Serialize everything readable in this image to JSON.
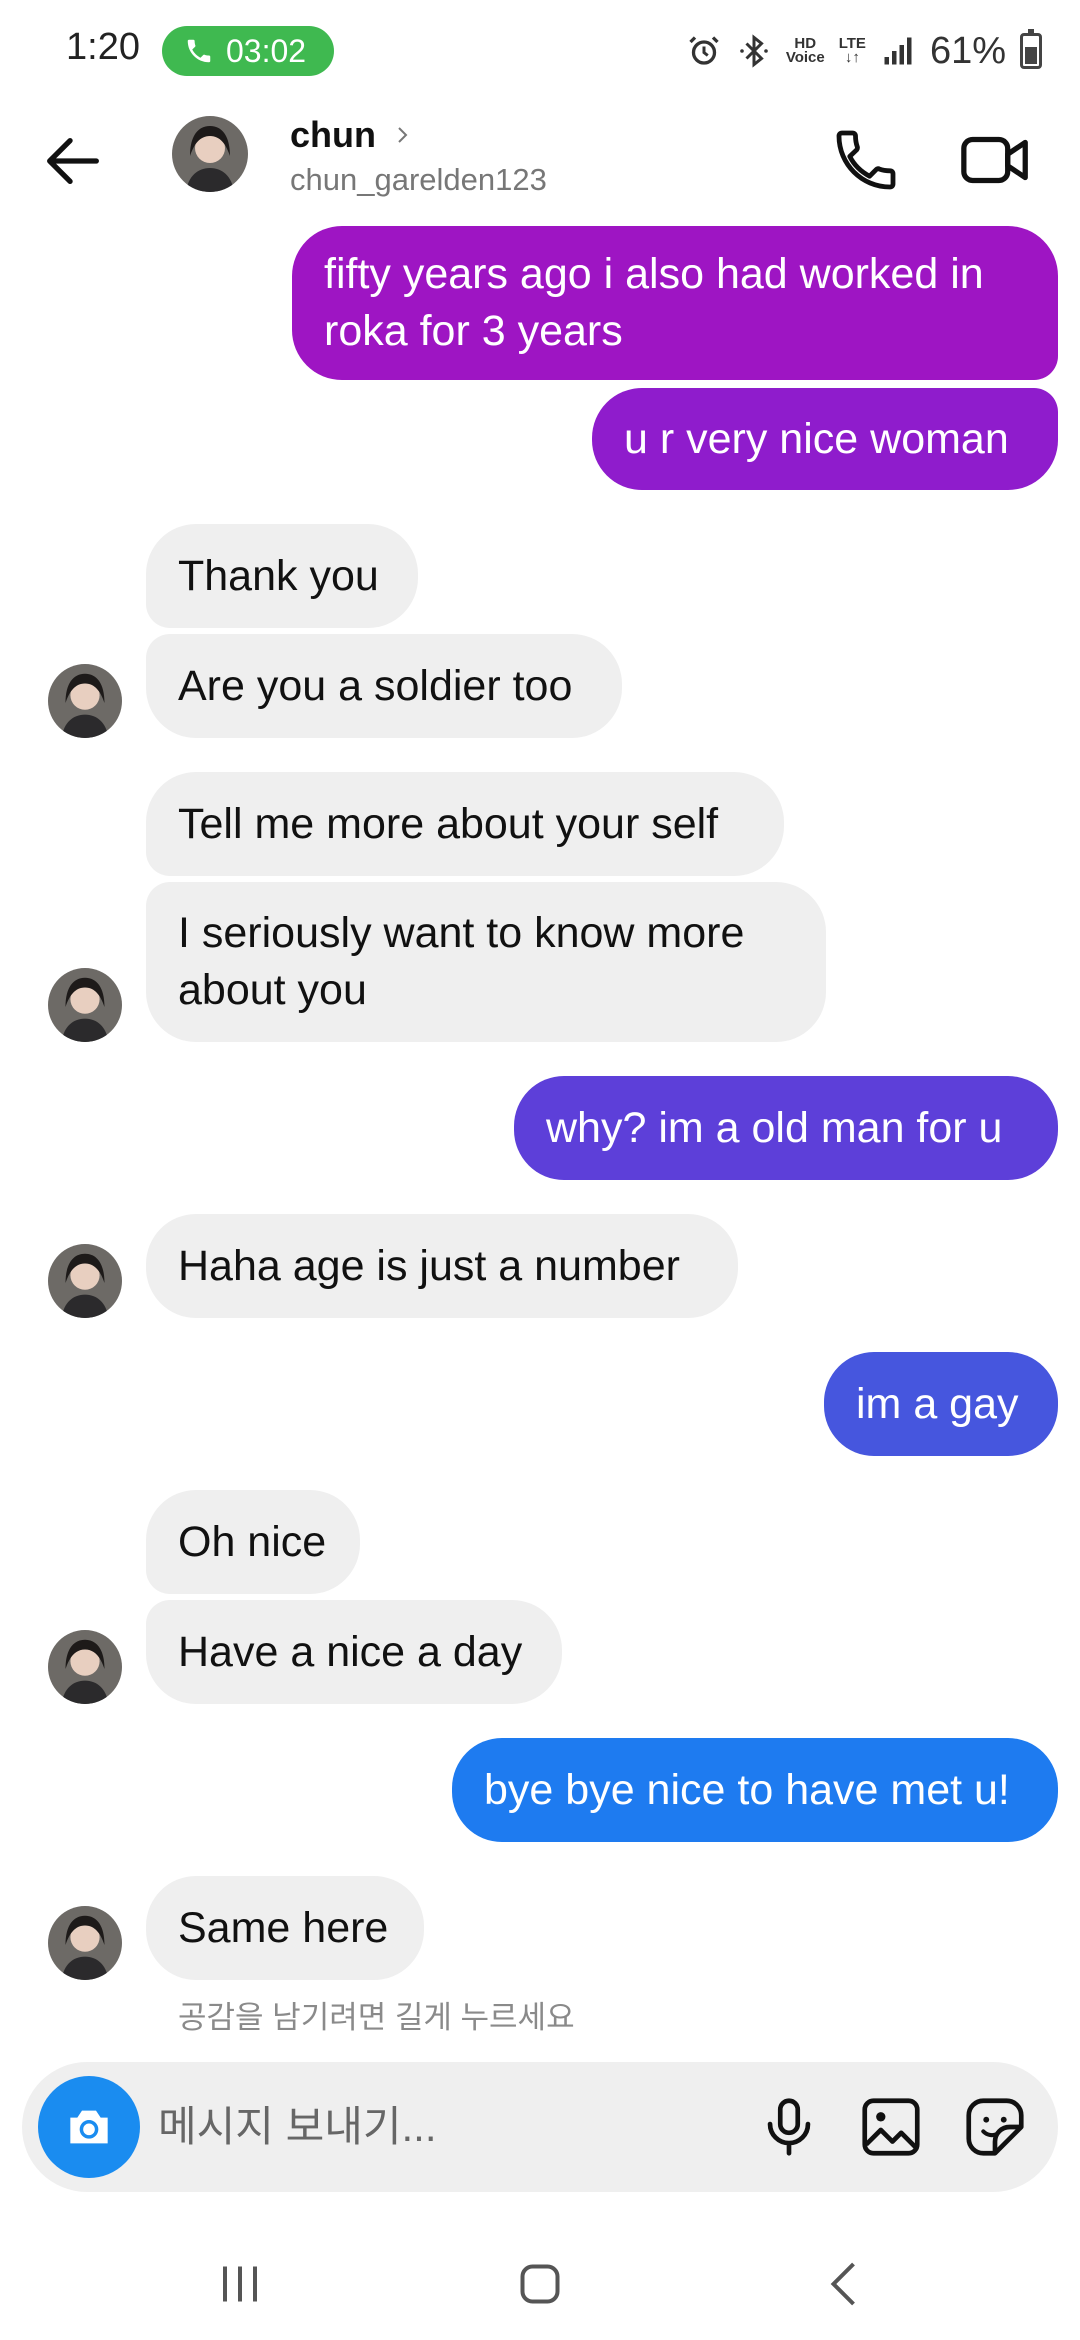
{
  "status_bar": {
    "time": "1:20",
    "call_timer": "03:02",
    "network": "LTE",
    "battery": "61%"
  },
  "header": {
    "name": "chun",
    "handle": "chun_garelden123"
  },
  "colors": {
    "sent_gradient": [
      "#9c14c4",
      "#8a1ed0",
      "#5e3ed9",
      "#4658df",
      "#1f7af0"
    ],
    "received_bg": "#efefef",
    "call_pill": "#3fb950",
    "camera_button": "#1a8cf0"
  },
  "messages": [
    {
      "side": "sent",
      "text": "fifty years ago i also had worked in\nroka for 3 years",
      "color": "#9e15c3"
    },
    {
      "side": "sent",
      "text": "u r very nice woman",
      "color": "#8f1ccc"
    },
    {
      "side": "received",
      "text": "Thank you"
    },
    {
      "side": "received",
      "text": "Are you a soldier too"
    },
    {
      "side": "received",
      "text": "Tell me more about your self"
    },
    {
      "side": "received",
      "text": "I seriously want to know more\nabout you"
    },
    {
      "side": "sent",
      "text": "why? im a old man for u",
      "color": "#5d3fd9"
    },
    {
      "side": "received",
      "text": "Haha age is just a number"
    },
    {
      "side": "sent",
      "text": "im a gay",
      "color": "#4656de"
    },
    {
      "side": "received",
      "text": "Oh nice"
    },
    {
      "side": "received",
      "text": "Have a nice a day"
    },
    {
      "side": "sent",
      "text": "bye bye nice to have met u!",
      "color": "#1e7bf0"
    },
    {
      "side": "received",
      "text": "Same here"
    }
  ],
  "reaction_hint": "공감을 남기려면 길게 누르세요",
  "composer": {
    "placeholder": "메시지 보내기..."
  },
  "icons": {
    "back": "arrow-left-icon",
    "audio_call": "phone-icon",
    "video_call": "video-camera-icon",
    "camera": "camera-icon",
    "mic": "microphone-icon",
    "gallery": "image-icon",
    "sticker": "sticker-icon"
  }
}
